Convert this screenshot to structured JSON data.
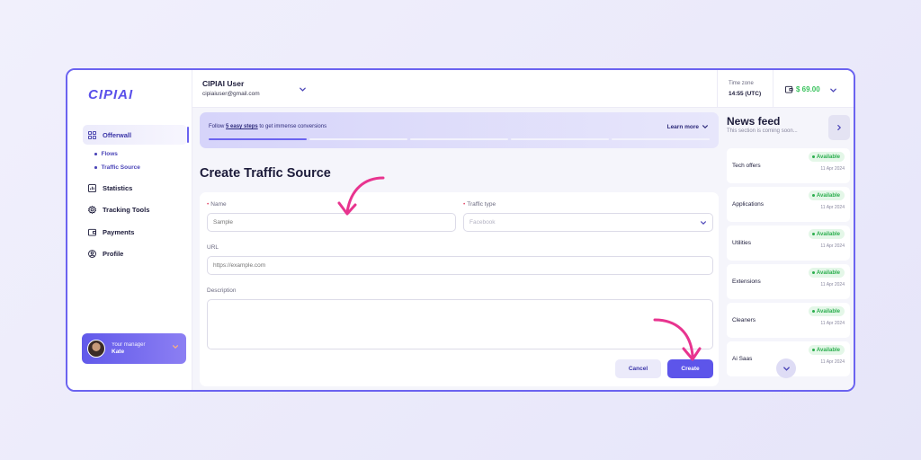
{
  "logo": "CIPIAI",
  "sidebar": {
    "items": [
      {
        "label": "Offerwall",
        "icon": "grid-icon"
      },
      {
        "label": "Statistics",
        "icon": "chart-icon"
      },
      {
        "label": "Tracking Tools",
        "icon": "gear-icon"
      },
      {
        "label": "Payments",
        "icon": "wallet-icon"
      },
      {
        "label": "Profile",
        "icon": "user-circle-icon"
      }
    ],
    "sub_items": [
      {
        "label": "Flows"
      },
      {
        "label": "Traffic Source"
      }
    ],
    "manager": {
      "title": "Your manager",
      "name": "Kate"
    }
  },
  "header": {
    "user_name": "CIPIAI User",
    "user_email": "cipiaiuser@gmail.com",
    "timezone_label": "Time zone",
    "timezone_value": "14:55 (UTC)",
    "balance": "$ 69.00"
  },
  "banner": {
    "prefix": "Follow ",
    "link": "5 easy steps",
    "suffix": " to get immense conversions",
    "learn_more": "Learn more",
    "steps_total": 5,
    "steps_done": 1
  },
  "page_title": "Create Traffic Source",
  "form": {
    "name_label": "Name",
    "name_placeholder": "Sample",
    "traffic_type_label": "Traffic type",
    "traffic_type_value": "Facebook",
    "url_label": "URL",
    "url_placeholder": "https://example.com",
    "description_label": "Description",
    "cancel": "Cancel",
    "create": "Create"
  },
  "news": {
    "title": "News feed",
    "subtitle": "This section is coming soon...",
    "items": [
      {
        "name": "Tech offers",
        "status": "Available",
        "date": "11 Apr 2024"
      },
      {
        "name": "Applications",
        "status": "Available",
        "date": "11 Apr 2024"
      },
      {
        "name": "Utilities",
        "status": "Available",
        "date": "11 Apr 2024"
      },
      {
        "name": "Extensions",
        "status": "Available",
        "date": "11 Apr 2024"
      },
      {
        "name": "Cleaners",
        "status": "Available",
        "date": "11 Apr 2024"
      },
      {
        "name": "Ai Saas",
        "status": "Available",
        "date": "11 Apr 2024"
      }
    ]
  },
  "colors": {
    "accent": "#6b63f0",
    "success": "#2bae4e",
    "annotation": "#e8348f"
  }
}
